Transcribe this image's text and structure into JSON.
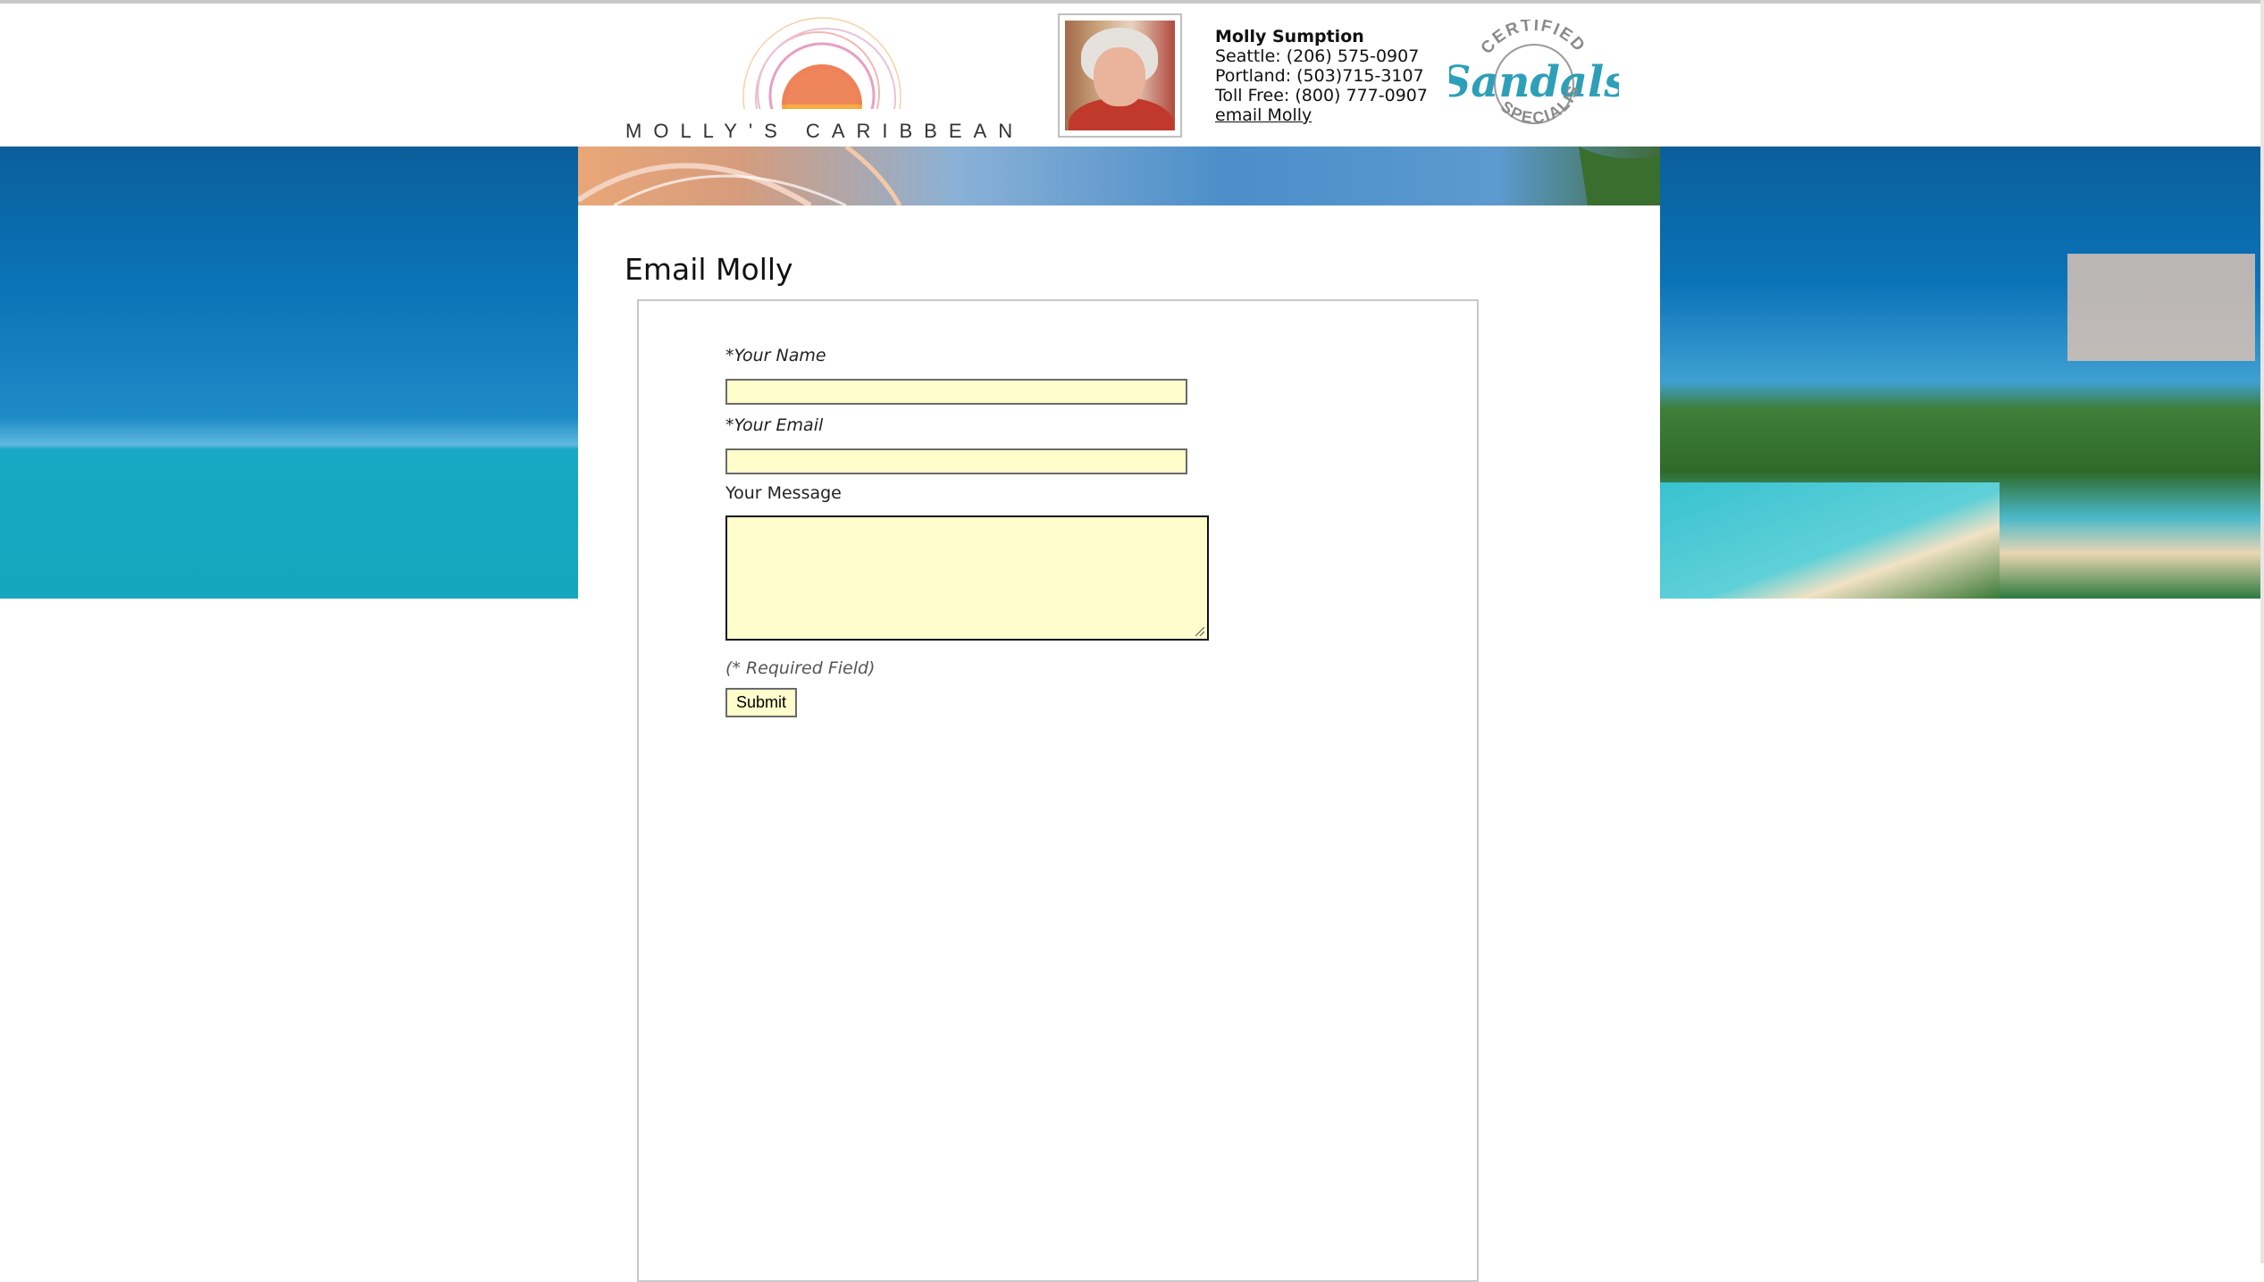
{
  "header": {
    "logo_text": "MOLLY'S CARIBBEAN",
    "contact": {
      "name": "Molly Sumption",
      "seattle": "Seattle: (206) 575-0907",
      "portland": "Portland: (503)715-3107",
      "toll_free": "Toll Free: (800) 777-0907",
      "email_link": "email Molly"
    },
    "badge": {
      "top_text": "CERTIFIED",
      "brand": "Sandals",
      "bottom_text": "SPECIALIST",
      "color": "#2e9fb8"
    }
  },
  "main": {
    "title": "Email Molly",
    "form": {
      "name_label": "*Your Name",
      "name_value": "",
      "email_label": "*Your Email",
      "email_value": "",
      "message_label": "Your Message",
      "message_value": "",
      "required_note": "(* Required Field)",
      "submit_label": "Submit"
    }
  },
  "colors": {
    "field_bg": "#fffdcb",
    "sea_blue": "#0a73b8",
    "sea_teal": "#17a9c5"
  }
}
